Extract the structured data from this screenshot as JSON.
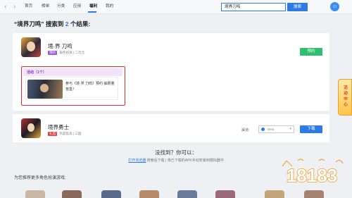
{
  "nav": {
    "back_icon": "chevron-left-icon",
    "forward_icon": "chevron-right-icon",
    "items": [
      {
        "label": "首页"
      },
      {
        "label": "榜单"
      },
      {
        "label": "分类"
      },
      {
        "label": "应用"
      },
      {
        "label": "福利"
      },
      {
        "label": "我的"
      }
    ],
    "active_index": 4
  },
  "search": {
    "value": "境界刀鸣",
    "button_label": "搜索"
  },
  "user": {
    "avatar_glyph": "☺"
  },
  "results": {
    "prefix": "“境界刀鸣” 搜索到 ",
    "count": "2",
    "suffix": " 个结果:"
  },
  "games": [
    {
      "title": "境·界 刀鸣",
      "tag": "预约",
      "meta": "角色扮演 | 二次元",
      "button_label": "预约",
      "activity": {
        "label": "活动（1个）",
        "text": "参与《境·界 刀鸣》预约 抽限量盲盒！"
      }
    },
    {
      "title": "境界勇士",
      "tag": "礼包",
      "meta": "热度极高 | 三国",
      "platform_label": "渠道:",
      "platform_value": "Meta",
      "button_label": "下载"
    }
  ],
  "not_found": {
    "title": "没找到？你可以：",
    "link": "打开浏览器",
    "text": " 搜索后下载 | 将已下载的APK手动安装到模拟器中"
  },
  "recommend": {
    "heading": "为您推荐更多角色扮演游戏:"
  },
  "float_badge": {
    "text": "活动中心"
  },
  "watermark": {
    "text": "18183"
  },
  "colors": {
    "accent": "#2d7be5",
    "green": "#2fbf71",
    "purple": "#9b57d6",
    "red": "#d9342b"
  }
}
